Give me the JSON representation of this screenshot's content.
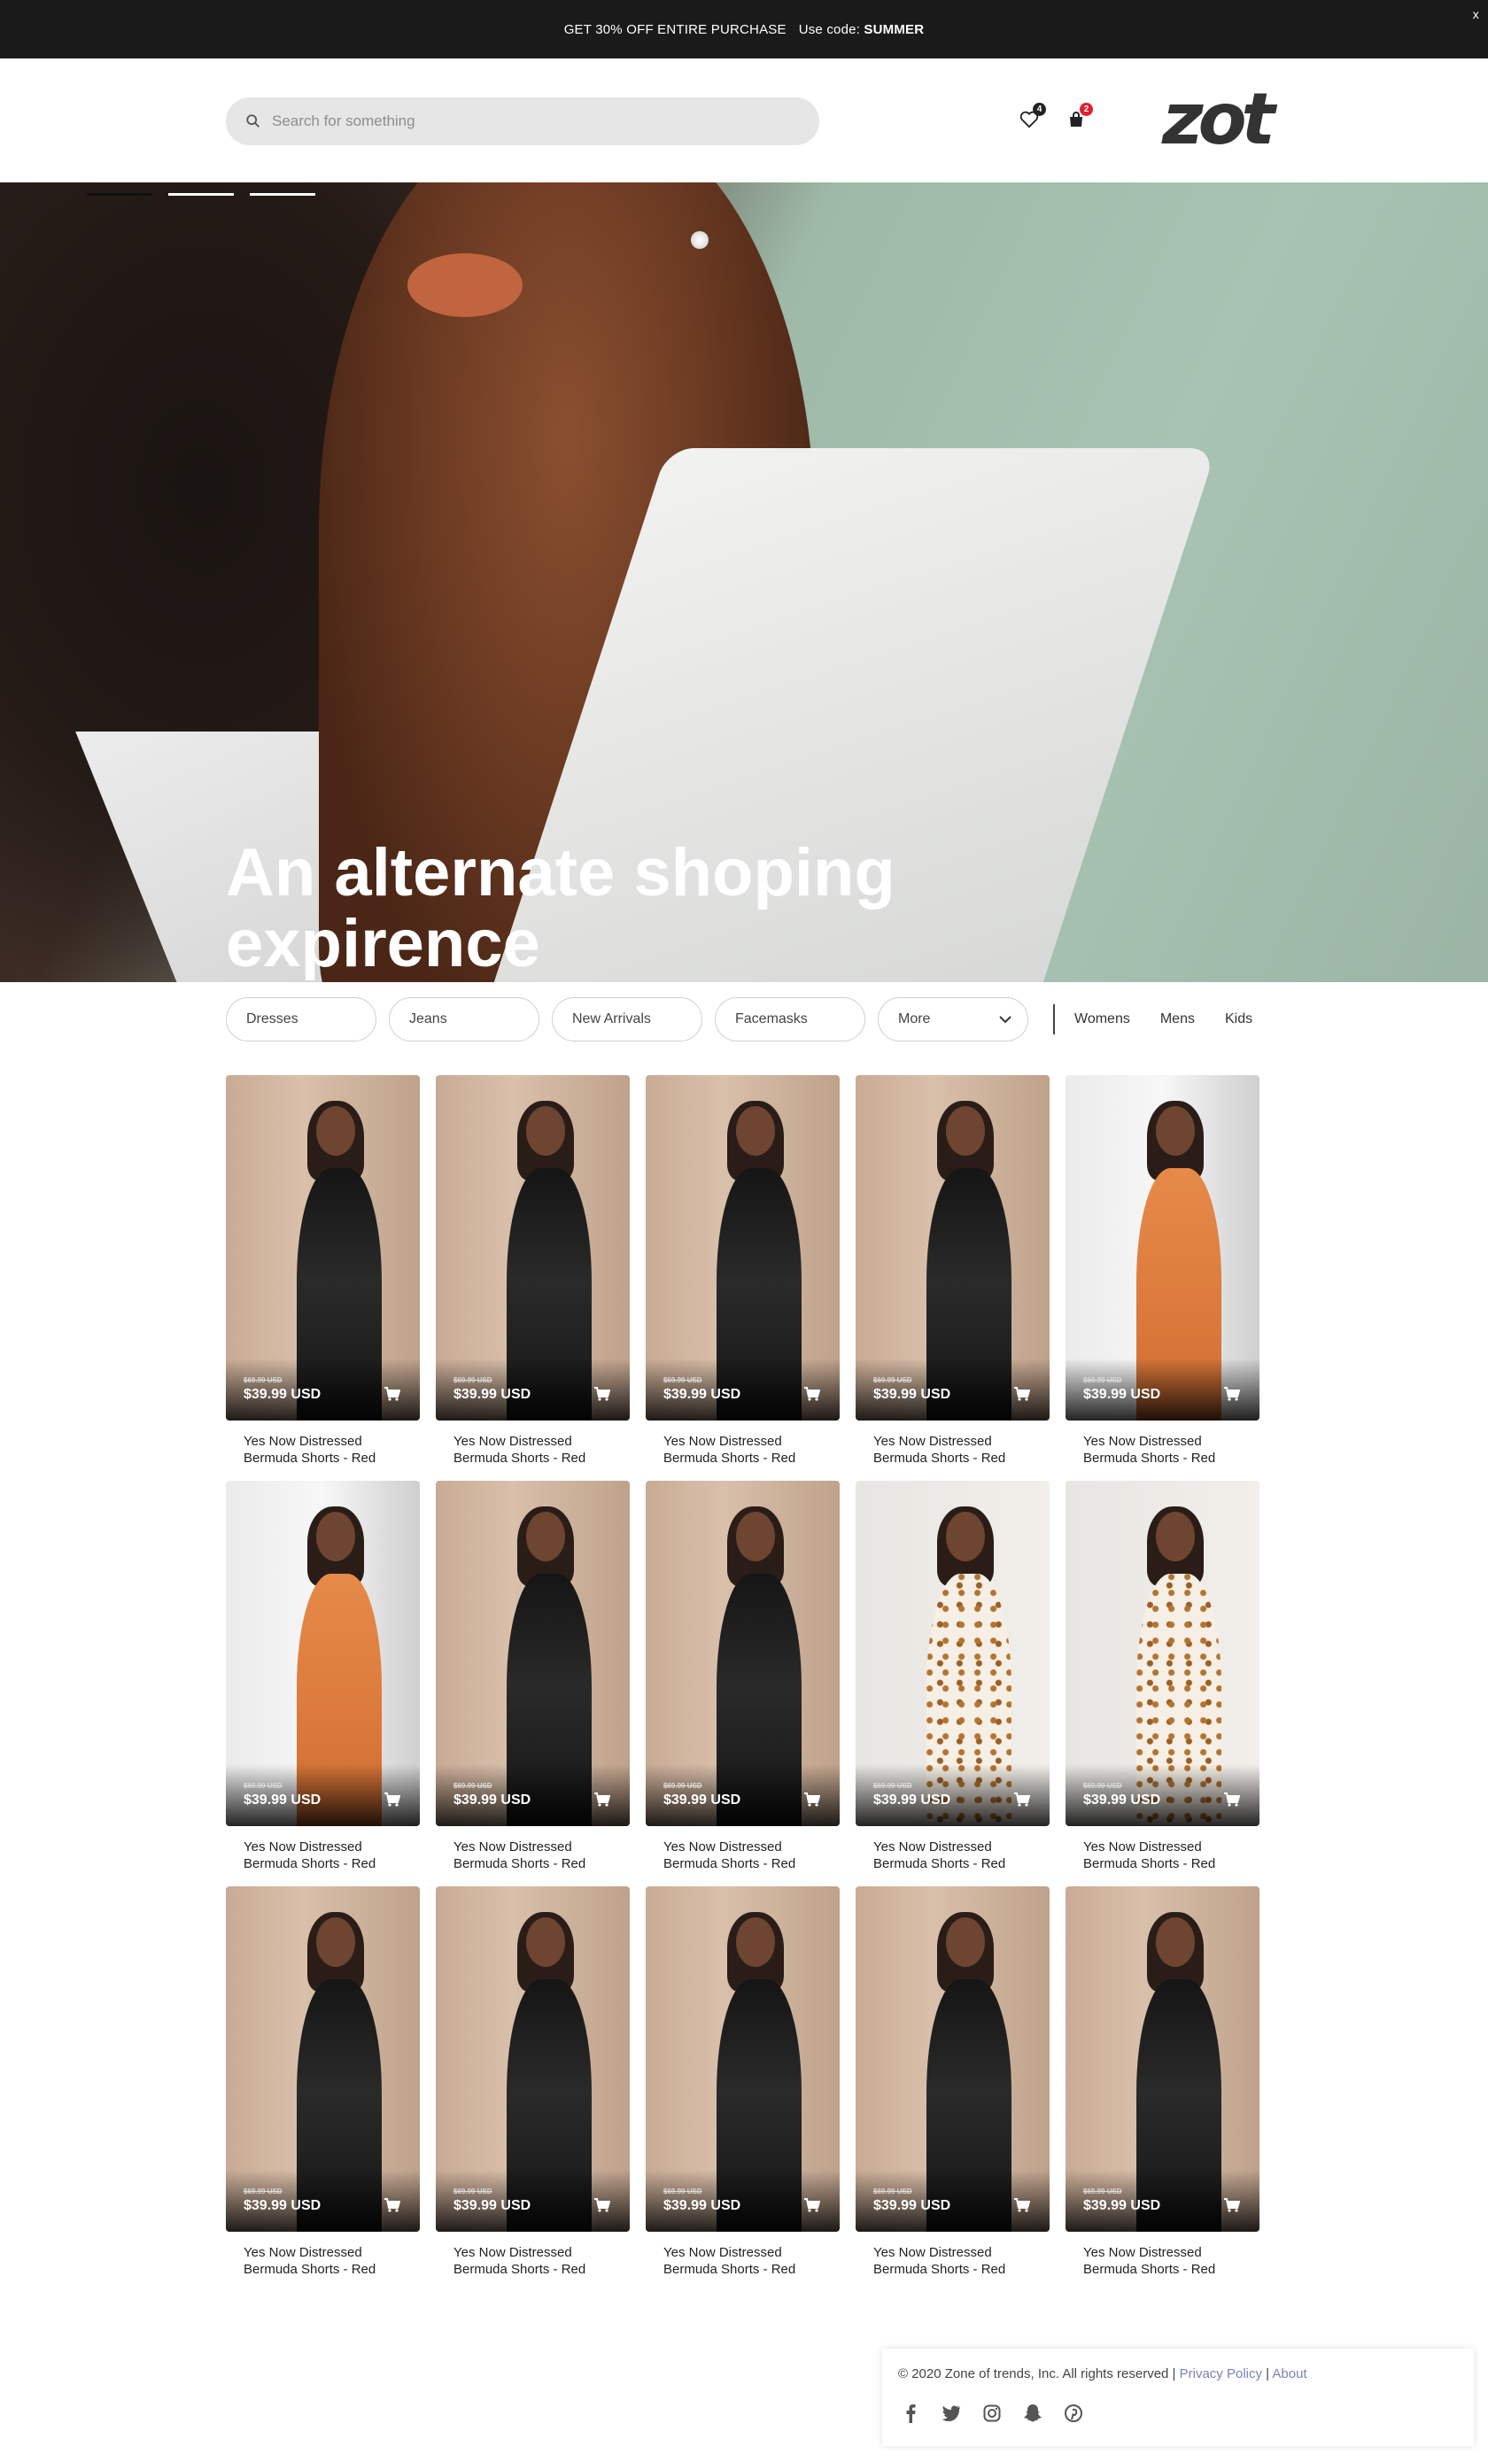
{
  "promo": {
    "text": "GET 30% OFF ENTIRE PURCHASE",
    "code_prefix": "Use code:",
    "code": "SUMMER",
    "close": "x"
  },
  "header": {
    "search_placeholder": "Search for something",
    "wishlist_count": "4",
    "cart_count": "2",
    "logo": "zot"
  },
  "hero": {
    "title_line1": "An alternate shoping",
    "title_line2": "expirence",
    "slides": 3,
    "active_slide": 0
  },
  "filters": {
    "categories": [
      "Dresses",
      "Jeans",
      "New Arrivals",
      "Facemasks"
    ],
    "more_label": "More",
    "genders": [
      "Womens",
      "Mens",
      "Kids"
    ]
  },
  "products": [
    {
      "old_price": "$69.99 USD",
      "price": "$39.99 USD",
      "name": "Yes Now Distressed Bermuda Shorts - Red",
      "style": "black"
    },
    {
      "old_price": "$69.99 USD",
      "price": "$39.99 USD",
      "name": "Yes Now Distressed Bermuda Shorts - Red",
      "style": "black"
    },
    {
      "old_price": "$69.99 USD",
      "price": "$39.99 USD",
      "name": "Yes Now Distressed Bermuda Shorts - Red",
      "style": "black"
    },
    {
      "old_price": "$69.99 USD",
      "price": "$39.99 USD",
      "name": "Yes Now Distressed Bermuda Shorts - Red",
      "style": "black"
    },
    {
      "old_price": "$69.99 USD",
      "price": "$39.99 USD",
      "name": "Yes Now Distressed Bermuda Shorts - Red",
      "style": "orange"
    },
    {
      "old_price": "$69.99 USD",
      "price": "$39.99 USD",
      "name": "Yes Now Distressed Bermuda Shorts - Red",
      "style": "orange"
    },
    {
      "old_price": "$69.99 USD",
      "price": "$39.99 USD",
      "name": "Yes Now Distressed Bermuda Shorts - Red",
      "style": "black"
    },
    {
      "old_price": "$69.99 USD",
      "price": "$39.99 USD",
      "name": "Yes Now Distressed Bermuda Shorts - Red",
      "style": "black"
    },
    {
      "old_price": "$69.99 USD",
      "price": "$39.99 USD",
      "name": "Yes Now Distressed Bermuda Shorts - Red",
      "style": "leopard"
    },
    {
      "old_price": "$69.99 USD",
      "price": "$39.99 USD",
      "name": "Yes Now Distressed Bermuda Shorts - Red",
      "style": "leopard"
    },
    {
      "old_price": "$69.99 USD",
      "price": "$39.99 USD",
      "name": "Yes Now Distressed Bermuda Shorts - Red",
      "style": "black"
    },
    {
      "old_price": "$69.99 USD",
      "price": "$39.99 USD",
      "name": "Yes Now Distressed Bermuda Shorts - Red",
      "style": "black"
    },
    {
      "old_price": "$69.99 USD",
      "price": "$39.99 USD",
      "name": "Yes Now Distressed Bermuda Shorts - Red",
      "style": "black"
    },
    {
      "old_price": "$69.99 USD",
      "price": "$39.99 USD",
      "name": "Yes Now Distressed Bermuda Shorts - Red",
      "style": "black"
    },
    {
      "old_price": "$69.99 USD",
      "price": "$39.99 USD",
      "name": "Yes Now Distressed Bermuda Shorts - Red",
      "style": "black"
    }
  ],
  "footer": {
    "copyright": "© 2020 Zone of trends, Inc. All rights reserved |",
    "privacy": "Privacy Policy",
    "sep": "|",
    "about": "About",
    "social_icons": [
      "facebook-icon",
      "twitter-icon",
      "instagram-icon",
      "snapchat-icon",
      "pinterest-icon"
    ]
  },
  "colors": {
    "promo_bg": "#1a1a1a",
    "badge_dark": "#222222",
    "badge_red": "#e0202e",
    "link": "#7a82b8"
  }
}
